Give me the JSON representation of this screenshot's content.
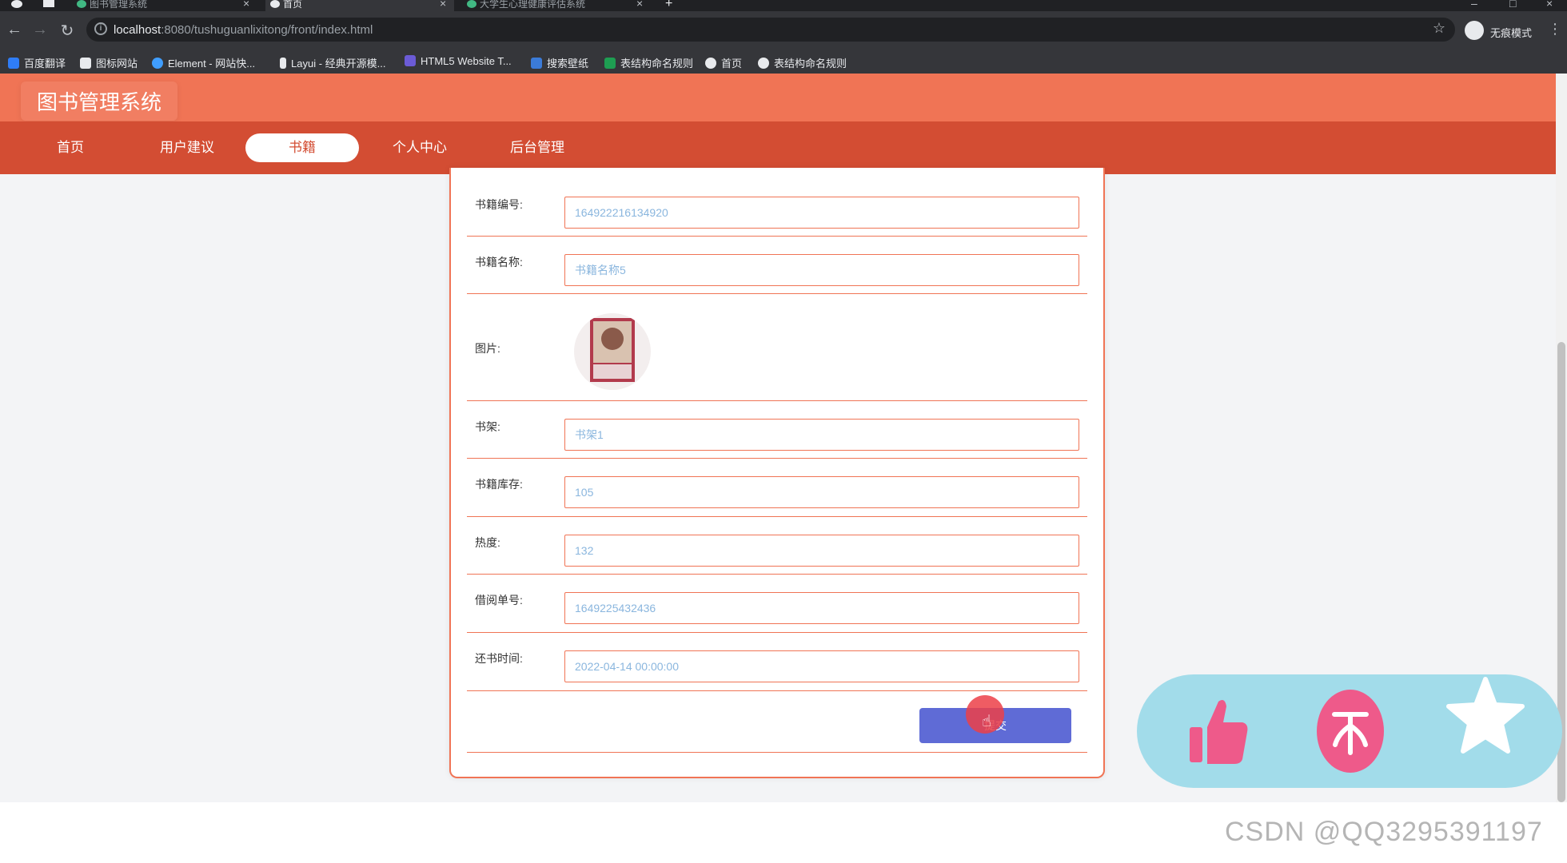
{
  "browser": {
    "tabs": [
      {
        "label": "图书管理系统",
        "active": false
      },
      {
        "label": "首页",
        "active": true
      },
      {
        "label": "大学生心理健康评估系统",
        "active": false
      }
    ],
    "new_tab_glyph": "+",
    "url_host": "localhost",
    "url_path": ":8080/tushuguanlixitong/front/index.html",
    "incognito_label": "无痕模式",
    "bookmarks": [
      {
        "label": "百度翻译",
        "icon": "translate-icon",
        "color": "#2f7df6"
      },
      {
        "label": "图标网站",
        "icon": "flag-icon",
        "color": "#e8eaed"
      },
      {
        "label": "Element - 网站快...",
        "icon": "element-icon",
        "color": "#409eff"
      },
      {
        "label": "Layui - 经典开源模...",
        "icon": "layui-icon",
        "color": "#e8eaed"
      },
      {
        "label": "HTML5 Website T...",
        "icon": "html5-icon",
        "color": "#6b5bd6"
      },
      {
        "label": "搜索壁纸",
        "icon": "wallpaper-icon",
        "color": "#3b7bd8"
      },
      {
        "label": "表结构命名规则",
        "icon": "sheet-icon",
        "color": "#1e9e52"
      },
      {
        "label": "首页",
        "icon": "globe-icon",
        "color": "#e8eaed"
      },
      {
        "label": "表结构命名规则",
        "icon": "globe-icon",
        "color": "#e8eaed"
      }
    ]
  },
  "site": {
    "title": "图书管理系统",
    "nav": [
      {
        "label": "首页",
        "active": false
      },
      {
        "label": "用户建议",
        "active": false
      },
      {
        "label": "书籍",
        "active": true
      },
      {
        "label": "个人中心",
        "active": false
      },
      {
        "label": "后台管理",
        "active": false
      }
    ]
  },
  "form": {
    "fields": [
      {
        "label": "书籍编号:",
        "value": "164922216134920"
      },
      {
        "label": "书籍名称:",
        "value": "书籍名称5"
      },
      {
        "label": "图片:",
        "value": ""
      },
      {
        "label": "书架:",
        "value": "书架1"
      },
      {
        "label": "书籍库存:",
        "value": "105"
      },
      {
        "label": "热度:",
        "value": "132"
      },
      {
        "label": "借阅单号:",
        "value": "1649225432436"
      },
      {
        "label": "还书时间:",
        "value": "2022-04-14 00:00:00"
      }
    ],
    "submit_label": "提交"
  },
  "actions": [
    {
      "icon": "thumbs-up-icon",
      "color": "#ee5a8a"
    },
    {
      "icon": "collect-icon",
      "color": "#ee5a8a"
    },
    {
      "icon": "star-icon",
      "color": "#ffffff"
    }
  ],
  "watermark": "CSDN @QQ3295391197",
  "colors": {
    "header": "#f07455",
    "nav": "#d34d33",
    "accent": "#f07455",
    "submit": "#5f6bd6",
    "input_text": "#8ab6de"
  }
}
